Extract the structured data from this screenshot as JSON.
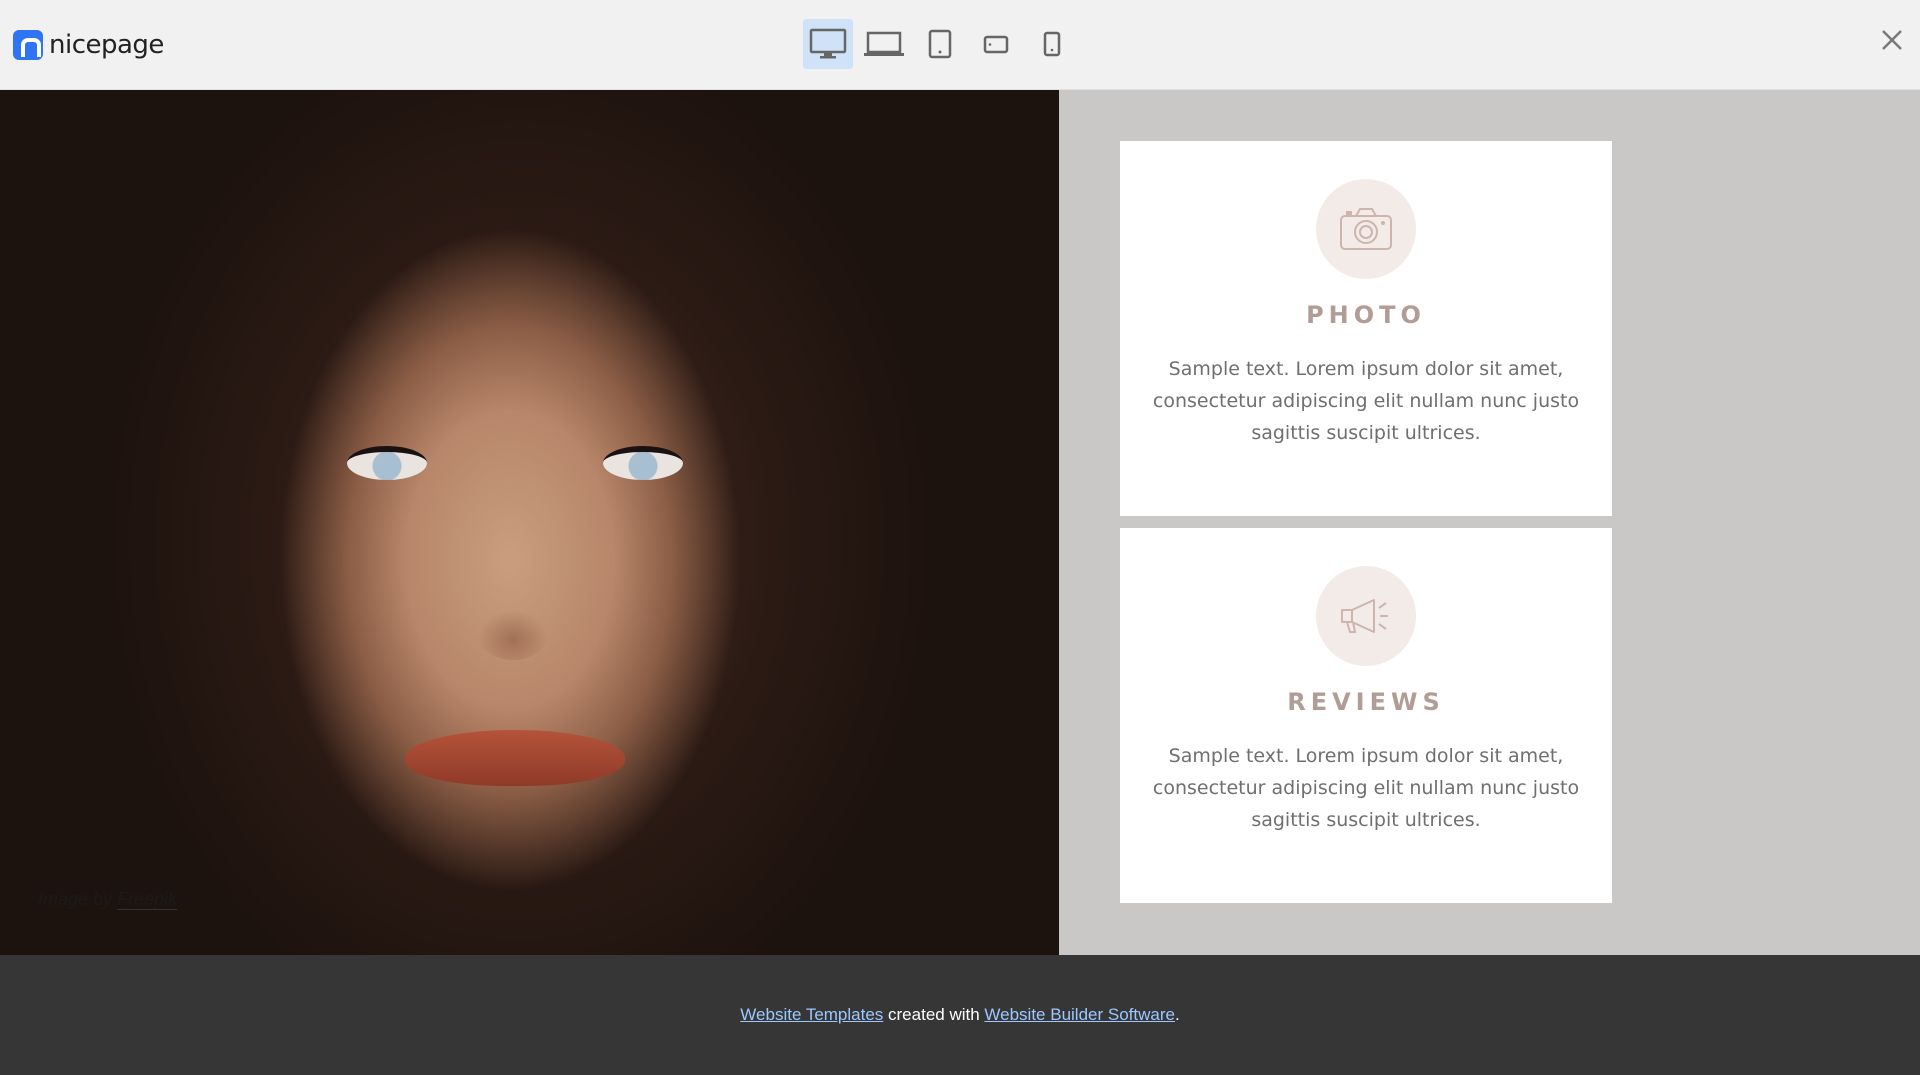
{
  "topbar": {
    "logo_text": "nicepage",
    "devices": [
      {
        "name": "desktop",
        "active": true
      },
      {
        "name": "laptop",
        "active": false
      },
      {
        "name": "tablet",
        "active": false
      },
      {
        "name": "tablet-landscape",
        "active": false
      },
      {
        "name": "phone",
        "active": false
      }
    ],
    "close_icon": "close-icon"
  },
  "hero": {
    "image_description_icon": "portrait-photo",
    "credit_prefix": "Image by",
    "credit_link": "Freepik"
  },
  "cards": [
    {
      "icon": "camera-icon",
      "title": "PHOTO",
      "text": "Sample text. Lorem ipsum dolor sit amet, consectetur adipiscing elit nullam nunc justo sagittis suscipit ultrices."
    },
    {
      "icon": "megaphone-icon",
      "title": "REVIEWS",
      "text": "Sample text. Lorem ipsum dolor sit amet, consectetur adipiscing elit nullam nunc justo sagittis suscipit ultrices."
    }
  ],
  "footer": {
    "link1": "Website Templates",
    "middle": " created with ",
    "link2": "Website Builder Software",
    "end": "."
  },
  "colors": {
    "accent": "#2f74f2",
    "card_title": "#b29c96",
    "panel_bg": "#c9c8c6",
    "footer_bg": "#363636",
    "footer_link": "#9cc7ff",
    "active_device_bg": "#cfe2f7"
  }
}
